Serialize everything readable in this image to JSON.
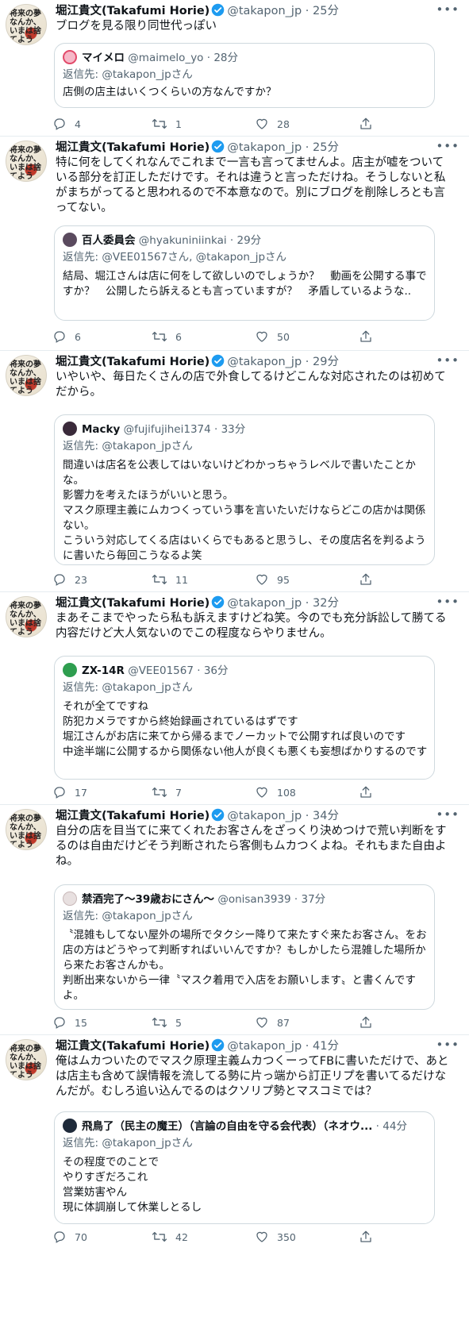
{
  "author": {
    "name": "堀江貴文(Takafumi Horie)",
    "handle": "@takapon_jp",
    "avatar_text": "将来の夢なんか、いまは捨てよう"
  },
  "reply_prefix": "返信先:",
  "tweets": [
    {
      "time": "25分",
      "text": "ブログを見る限り同世代っぽい",
      "quote": {
        "name": "マイメロ",
        "handle": "@maimelo_yo",
        "time": "28分",
        "reply_to": "@takapon_jpさん",
        "text": "店側の店主はいくつくらいの方なんですか？",
        "avatar_color": "#f6b8c8"
      },
      "counts": {
        "reply": "4",
        "retweet": "1",
        "like": "28"
      }
    },
    {
      "time": "25分",
      "text": "特に何をしてくれなんでこれまで一言も言ってませんよ。店主が嘘をついている部分を訂正しただけです。それは違うと言っただけね。そうしないと私がまちがってると思われるので不本意なので。別にブログを削除しろとも言ってない。",
      "quote": {
        "name": "百人委員会",
        "handle": "@hyakuniniinkai",
        "time": "29分",
        "reply_to": "@VEE01567さん, @takapon_jpさん",
        "text": "結局、堀江さんは店に何をして欲しいのでしょうか？　動画を公開する事ですか？　公開したら訴えるとも言っていますが？　矛盾しているような..",
        "avatar_color": "#5a4a5e"
      },
      "counts": {
        "reply": "6",
        "retweet": "6",
        "like": "50"
      }
    },
    {
      "time": "29分",
      "text": "いやいや、毎日たくさんの店で外食してるけどこんな対応されたのは初めてだから。",
      "quote": {
        "name": "Macky",
        "handle": "@fujifujihei1374",
        "time": "33分",
        "reply_to": "@takapon_jpさん",
        "text": "間違いは店名を公表してはいないけどわかっちゃうレベルで書いたことかな。\n影響力を考えたほうがいいと思う。\nマスク原理主義にムカつくっていう事を言いたいだけならどこの店かは関係ない。\nこういう対応してくる店はいくらでもあると思うし、その度店名を判るように書いたら毎回こうなるよ笑",
        "avatar_color": "#3a2a3a"
      },
      "counts": {
        "reply": "23",
        "retweet": "11",
        "like": "95"
      }
    },
    {
      "time": "32分",
      "text": "まあそこまでやったら私も訴えますけどね笑。今のでも充分訴訟して勝てる内容だけど大人気ないのでこの程度ならやりません。",
      "quote": {
        "name": "ZX-14R",
        "handle": "@VEE01567",
        "time": "36分",
        "reply_to": "@takapon_jpさん",
        "text": "それが全てですね\n防犯カメラですから終始録画されているはずです\n堀江さんがお店に来てから帰るまでノーカットで公開すれば良いのです\n中途半端に公開するから関係ない他人が良くも悪くも妄想ばかりするのです",
        "avatar_color": "#2e9e4f"
      },
      "counts": {
        "reply": "17",
        "retweet": "7",
        "like": "108"
      }
    },
    {
      "time": "34分",
      "text": "自分の店を目当てに来てくれたお客さんをざっくり決めつけで荒い判断をするのは自由だけどそう判断されたら客側もムカつくよね。それもまた自由よね。",
      "quote": {
        "name": "禁酒完了〜39歳おにさん〜",
        "handle": "@onisan3939",
        "time": "37分",
        "reply_to": "@takapon_jpさん",
        "text": "〝混雑もしてない屋外の場所でタクシー降りて来たすぐ来たお客さん〟をお店の方はどうやって判断すればいいんですか？もしかしたら混雑した場所から来たお客さんかも。\n判断出来ないから一律〝マスク着用で入店をお願いします〟と書くんですよ。",
        "avatar_color": "#e8e0e0"
      },
      "counts": {
        "reply": "15",
        "retweet": "5",
        "like": "87"
      }
    },
    {
      "time": "41分",
      "text": "俺はムカついたのでマスク原理主義ムカつくーってFBに書いただけで、あとは店主も含めて誤情報を流してる勢に片っ端から訂正リプを書いてるだけなんだが。むしろ追い込んでるのはクソリプ勢とマスコミでは？",
      "quote": {
        "name": "飛鳥了（民主の魔王）（言論の自由を守る会代表）（ネオウ...",
        "handle": "",
        "time": "44分",
        "reply_to": "@takapon_jpさん",
        "text": "その程度でのことで\nやりすぎだろこれ\n営業妨害やん\n現に体調崩して休業しとるし",
        "avatar_color": "#1f2a3a"
      },
      "counts": {
        "reply": "70",
        "retweet": "42",
        "like": "350"
      }
    }
  ]
}
